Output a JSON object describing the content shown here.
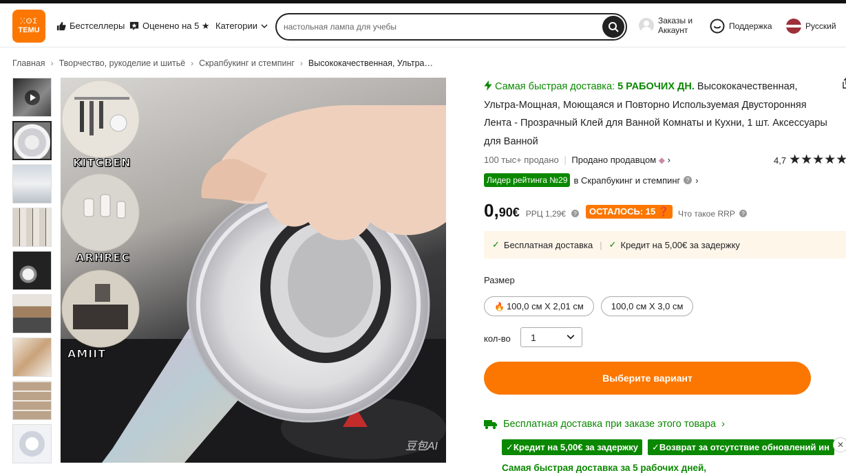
{
  "header": {
    "logo_glyphs": "ⵘⵙⵉ",
    "logo_text": "TEMU",
    "bestsellers": "Бестселлеры",
    "rated5": "Оценено на 5 ★",
    "categories": "Категории",
    "search_placeholder": "настольная лампа для учебы",
    "account_line1": "Заказы и",
    "account_line2": "Аккаунт",
    "support": "Поддержка",
    "language": "Русский"
  },
  "breadcrumb": {
    "items": [
      "Главная",
      "Творчество, рукоделие и шитьё",
      "Скрапбукинг и стемпинг"
    ],
    "current": "Высококачественная, Ультра…",
    "separator": "›"
  },
  "gallery": {
    "labels": [
      "KITCBEN",
      "ARHREC",
      "AMIIT"
    ],
    "watermark": "豆包AI"
  },
  "product": {
    "fast_prefix": "Самая быстрая доставка:",
    "fast_days": "5 РАБОЧИХ ДН.",
    "title": "Высококачественная, Ультра-Мощная, Моющаяся и Повторно Используемая Двусторонняя Лента - Прозрачный Клей для Ванной Комнаты и Кухни, 1 шт. Аксессуары для Ванной",
    "sold": "100 тыс+ продано",
    "seller": "Продано продавцом",
    "rating_value": "4,7",
    "stars": "★★★★★",
    "rank_badge": "Лидер рейтинга №29",
    "rank_category": "в Скрапбукинг и стемпинг",
    "price_int": "0,",
    "price_frac": "90€",
    "rrp": "РРЦ 1,29€",
    "left_badge": "ОСТАЛОСЬ: 15",
    "rrp_what": "Что такое RRP",
    "perk_free": "Бесплатная доставка",
    "perk_credit": "Кредит на 5,00€ за задержку",
    "size_label": "Размер",
    "size_options": [
      "100,0 см X 2,01 см",
      "100,0 см X 3,0 см"
    ],
    "qty_label": "кол-во",
    "qty_value": "1",
    "cta": "Выберите вариант",
    "free_ship_order": "Бесплатная доставка при заказе этого товара",
    "tag_credit": "Кредит на 5,00€ за задержку",
    "tag_refund": "Возврат за отсутствие обновлений ин",
    "fast_bottom": "Самая быстрая доставка за 5 рабочих дней,"
  },
  "colors": {
    "brand": "#fb7701",
    "green": "#0a8800"
  }
}
